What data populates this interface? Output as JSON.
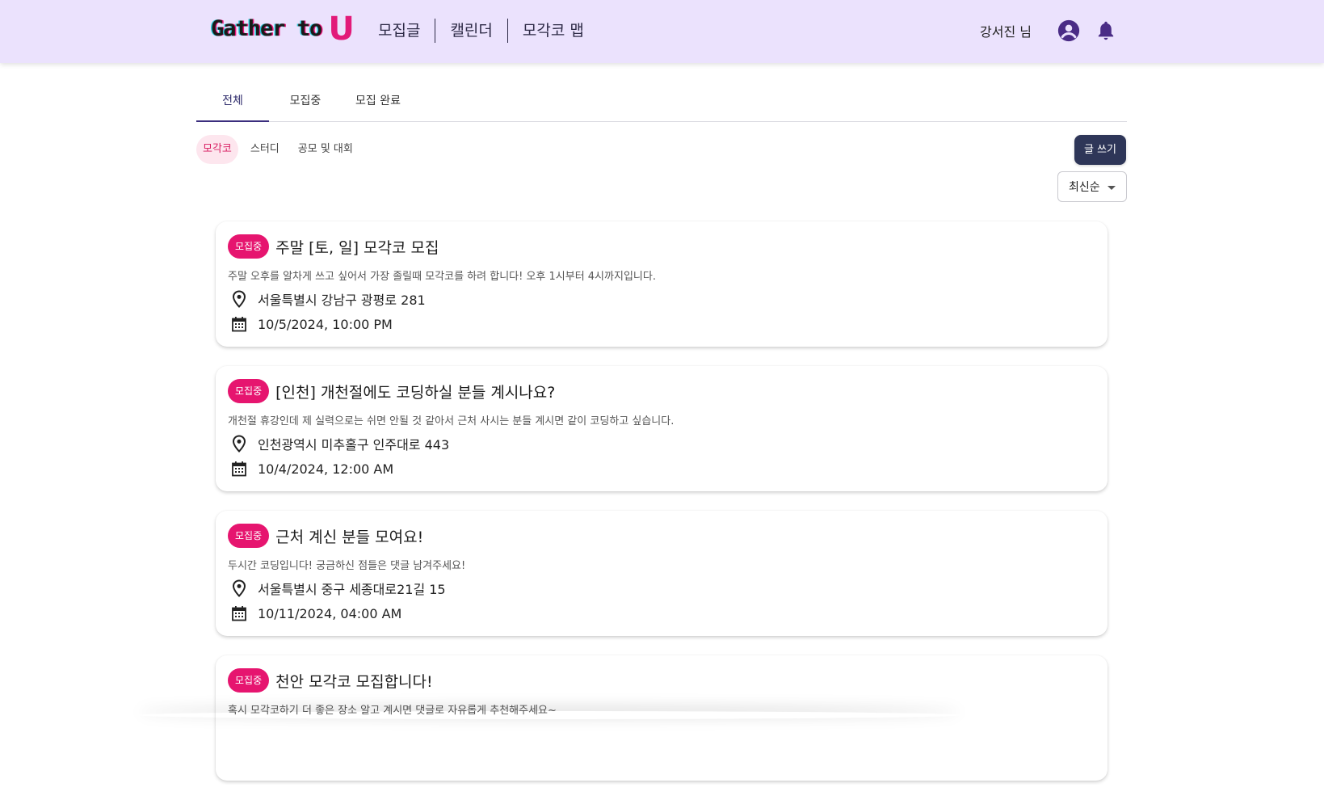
{
  "header": {
    "logo_text": "Gather to",
    "logo_accent": "U",
    "nav": [
      "모집글",
      "캘린더",
      "모각코 맵"
    ],
    "user_name": "강서진 님"
  },
  "tabs": [
    {
      "label": "전체",
      "active": true
    },
    {
      "label": "모집중",
      "active": false
    },
    {
      "label": "모집 완료",
      "active": false
    }
  ],
  "chips": [
    {
      "label": "모각코",
      "active": true
    },
    {
      "label": "스터디",
      "active": false
    },
    {
      "label": "공모 및 대회",
      "active": false
    }
  ],
  "write_button": "글 쓰기",
  "sort": {
    "selected": "최신순"
  },
  "posts": [
    {
      "badge": "모집중",
      "title": "주말 [토, 일] 모각코 모집",
      "desc": "주말 오후를 알차게 쓰고 싶어서 가장 졸릴때 모각코를 하려 합니다! 오후 1시부터 4시까지입니다.",
      "location": "서울특별시 강남구 광평로 281",
      "date": "10/5/2024, 10:00 PM"
    },
    {
      "badge": "모집중",
      "title": "[인천] 개천절에도 코딩하실 분들 계시나요?",
      "desc": "개천절 휴강인데 제 실력으로는 쉬면 안될 것 같아서 근처 사시는 분들 계시면 같이 코딩하고 싶습니다.",
      "location": "인천광역시 미추홀구 인주대로 443",
      "date": "10/4/2024, 12:00 AM"
    },
    {
      "badge": "모집중",
      "title": "근처 계신 분들 모여요!",
      "desc": "두시간 코딩입니다! 궁금하신 점들은 댓글 남겨주세요!",
      "location": "서울특별시 중구 세종대로21길 15",
      "date": "10/11/2024, 04:00 AM"
    },
    {
      "badge": "모집중",
      "title": "천안 모각코 모집합니다!",
      "desc": "혹시 모각코하기 더 좋은 장소 알고 계시면 댓글로 자유롭게 추천해주세요~",
      "location": "",
      "date": ""
    }
  ],
  "colors": {
    "header_bg": "#ebe2fd",
    "badge": "#e6156f",
    "write_button": "#2e3658",
    "tab_indicator": "#3b2e7e",
    "icon_purple": "#4a2c86"
  },
  "icons": {
    "profile": "account-circle-icon",
    "notifications": "bell-icon",
    "location": "map-pin-icon",
    "date": "calendar-icon",
    "sort_caret": "caret-down-icon"
  }
}
